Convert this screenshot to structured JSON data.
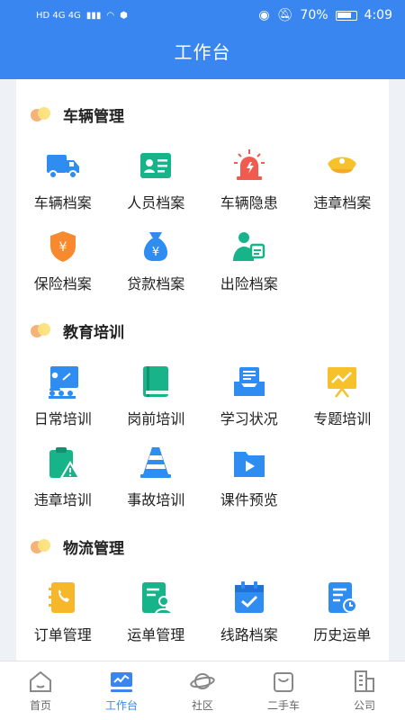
{
  "status": {
    "net_left": "HD 4G 4G",
    "percent": "70%",
    "time": "4:09"
  },
  "header": {
    "title": "工作台"
  },
  "colors": {
    "brand": "#3a86f0"
  },
  "sections": [
    {
      "title": "车辆管理",
      "items": [
        {
          "label": "车辆档案",
          "icon": "truck-icon"
        },
        {
          "label": "人员档案",
          "icon": "id-card-icon"
        },
        {
          "label": "车辆隐患",
          "icon": "alarm-light-icon"
        },
        {
          "label": "违章档案",
          "icon": "police-cap-icon"
        },
        {
          "label": "保险档案",
          "icon": "yuan-shield-icon"
        },
        {
          "label": "贷款档案",
          "icon": "money-bag-icon"
        },
        {
          "label": "出险档案",
          "icon": "person-report-icon"
        }
      ]
    },
    {
      "title": "教育培训",
      "items": [
        {
          "label": "日常培训",
          "icon": "teacher-board-icon"
        },
        {
          "label": "岗前培训",
          "icon": "book-icon"
        },
        {
          "label": "学习状况",
          "icon": "inbox-list-icon"
        },
        {
          "label": "专题培训",
          "icon": "chart-easel-icon"
        },
        {
          "label": "违章培训",
          "icon": "clipboard-warning-icon"
        },
        {
          "label": "事故培训",
          "icon": "traffic-cone-icon"
        },
        {
          "label": "课件预览",
          "icon": "video-folder-icon"
        }
      ]
    },
    {
      "title": "物流管理",
      "items": [
        {
          "label": "订单管理",
          "icon": "phone-book-icon"
        },
        {
          "label": "运单管理",
          "icon": "user-document-icon"
        },
        {
          "label": "线路档案",
          "icon": "calendar-check-icon"
        },
        {
          "label": "历史运单",
          "icon": "document-clock-icon"
        }
      ]
    }
  ],
  "tabbar": [
    {
      "label": "首页",
      "icon": "home-icon",
      "active": false
    },
    {
      "label": "工作台",
      "icon": "monitor-chart-icon",
      "active": true
    },
    {
      "label": "社区",
      "icon": "planet-icon",
      "active": false
    },
    {
      "label": "二手车",
      "icon": "shopping-bag-icon",
      "active": false
    },
    {
      "label": "公司",
      "icon": "building-icon",
      "active": false
    }
  ]
}
